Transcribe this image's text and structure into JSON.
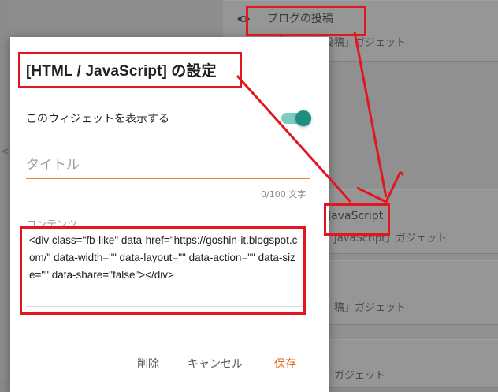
{
  "background": {
    "gadgets": [
      {
        "title": "ブログの投稿",
        "subtitle": "「ブログの投稿」ガジェット"
      },
      {
        "title": "JavaScript",
        "subtitle": "JavaScript」ガジェット"
      },
      {
        "title": "",
        "subtitle": "稿」ガジェット"
      },
      {
        "title": "",
        "subtitle": "ガジェット"
      }
    ],
    "left_glyph": "<"
  },
  "dialog": {
    "title": "[HTML / JavaScript] の設定",
    "show_widget_label": "このウィジェットを表示する",
    "show_widget_on": true,
    "title_field": {
      "placeholder": "タイトル",
      "value": ""
    },
    "counter": "0/100 文字",
    "content_label": "コンテンツ",
    "content_value": "<div class=\"fb-like\" data-href=\"https://goshin-it.blogspot.com/\" data-width=\"\" data-layout=\"\" data-action=\"\" data-size=\"\" data-share=\"false\"></div>",
    "buttons": {
      "delete": "削除",
      "cancel": "キャンセル",
      "save": "保存"
    }
  },
  "colors": {
    "accent_orange": "#e06c1c",
    "toggle_teal": "#1d8f7f",
    "annotation_red": "#e3161f"
  }
}
